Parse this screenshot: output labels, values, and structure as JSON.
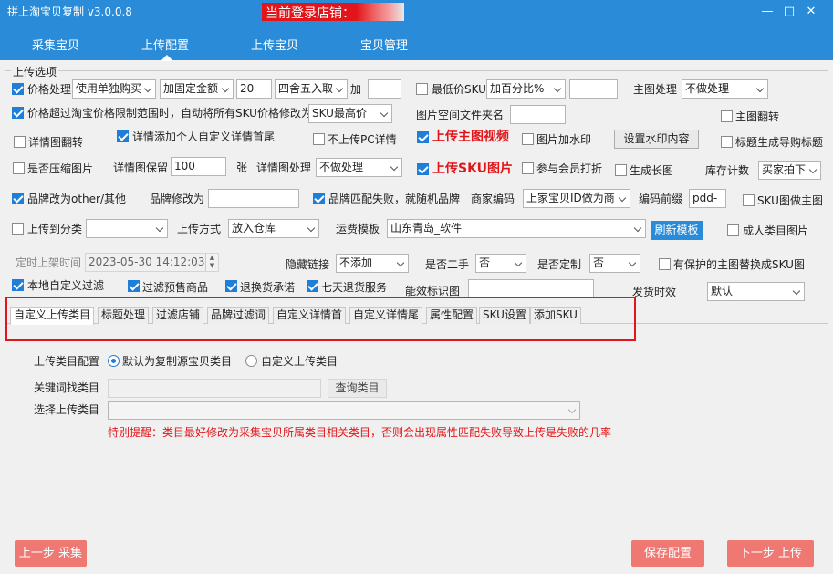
{
  "app": {
    "title": "拼上淘宝贝复制 v3.0.0.8",
    "login_label": "当前登录店铺：",
    "window_controls": {
      "minimize": "—",
      "restore": "□",
      "close": "✕"
    }
  },
  "nav": {
    "tabs": [
      "采集宝贝",
      "上传配置",
      "上传宝贝",
      "宝贝管理"
    ],
    "active": "上传配置"
  },
  "group": {
    "title": "上传选项"
  },
  "row1": {
    "price_process": {
      "label": "价格处理",
      "checked": true,
      "mode": "使用单独购买",
      "adjust": "加固定金额",
      "amount": "20",
      "rounding": "四舍五入取",
      "plus": "加",
      "plus_value": ""
    },
    "min_price_sku": {
      "label": "最低价SKU",
      "checked": false,
      "mode": "加百分比%",
      "value": ""
    },
    "main_image": {
      "label": "主图处理",
      "value": "不做处理"
    }
  },
  "row2": {
    "limit_price": {
      "label": "价格超过淘宝价格限制范围时，自动将所有SKU价格修改为",
      "checked": true,
      "value": "SKU最高价"
    },
    "image_folder": {
      "label": "图片空间文件夹名",
      "value": ""
    },
    "main_flip": {
      "label": "主图翻转",
      "checked": false
    }
  },
  "row3": {
    "detail_flip": {
      "label": "详情图翻转",
      "checked": false
    },
    "detail_custom": {
      "label": "详情添加个人自定义详情首尾",
      "checked": true
    },
    "no_pc_detail": {
      "label": "不上传PC详情",
      "checked": false
    },
    "main_video": {
      "label": "上传主图视频",
      "checked": true
    },
    "watermark": {
      "label": "图片加水印",
      "checked": false
    },
    "watermark_btn": "设置水印内容",
    "guide_title": {
      "label": "标题生成导购标题",
      "checked": false
    }
  },
  "row4": {
    "compress": {
      "label": "是否压缩图片",
      "checked": false
    },
    "detail_keep": {
      "label": "详情图保留",
      "value": "100",
      "unit": "张"
    },
    "detail_process": {
      "label": "详情图处理",
      "value": "不做处理"
    },
    "sku_image": {
      "label": "上传SKU图片",
      "checked": true
    },
    "member_discount": {
      "label": "参与会员打折",
      "checked": false
    },
    "long_image": {
      "label": "生成长图",
      "checked": false
    },
    "stock_count": {
      "label": "库存计数",
      "value": "买家拍下"
    }
  },
  "row5": {
    "brand_other": {
      "label": "品牌改为other/其他",
      "checked": true
    },
    "brand_change": {
      "label": "品牌修改为",
      "value": ""
    },
    "brand_match": {
      "label": "品牌匹配失败，就随机品牌",
      "checked": true
    },
    "merchant_code": {
      "label": "商家编码",
      "value": "上家宝贝ID做为商"
    },
    "code_prefix": {
      "label": "编码前缀",
      "value": "pdd-"
    },
    "sku_as_main": {
      "label": "SKU图做主图",
      "checked": false
    }
  },
  "row6": {
    "upload_category": {
      "label": "上传到分类",
      "checked": false,
      "value": ""
    },
    "upload_mode": {
      "label": "上传方式",
      "value": "放入仓库"
    },
    "shipping_template": {
      "label": "运费模板",
      "value": "山东青岛_软件"
    },
    "refresh_btn": "刷新模板",
    "adult_category": {
      "label": "成人类目图片",
      "checked": false
    }
  },
  "row7": {
    "schedule": {
      "label": "定时上架时间",
      "value": "2023-05-30 14:12:03"
    },
    "hidden_link": {
      "label": "隐藏链接",
      "value": "不添加"
    },
    "second_hand": {
      "label": "是否二手",
      "value": "否"
    },
    "customized": {
      "label": "是否定制",
      "value": "否"
    },
    "protected_main": {
      "label": "有保护的主图替换成SKU图",
      "checked": false
    }
  },
  "row8": {
    "local_filter": {
      "label": "本地自定义过滤",
      "checked": true
    },
    "filter_presale": {
      "label": "过滤预售商品",
      "checked": true
    },
    "refund_promise": {
      "label": "退换货承诺",
      "checked": true
    },
    "seven_day": {
      "label": "七天退货服务",
      "checked": true
    },
    "efficiency_icon": {
      "label": "能效标识图",
      "value": ""
    },
    "ship_time": {
      "label": "发货时效",
      "value": "默认"
    }
  },
  "subtabs": {
    "items": [
      "自定义上传类目",
      "标题处理",
      "过滤店铺",
      "品牌过滤词",
      "自定义详情首",
      "自定义详情尾",
      "属性配置",
      "SKU设置",
      "添加SKU"
    ],
    "active": "自定义上传类目"
  },
  "category_panel": {
    "config_label": "上传类目配置",
    "option_default": "默认为复制源宝贝类目",
    "option_custom": "自定义上传类目",
    "selected": "默认为复制源宝贝类目",
    "keyword_label": "关键词找类目",
    "keyword_value": "",
    "search_btn": "查询类目",
    "select_label": "选择上传类目",
    "select_value": "",
    "warning": "特别提醒：类目最好修改为采集宝贝所属类目相关类目，否则会出现属性匹配失败导致上传是失败的几率"
  },
  "footer": {
    "prev": "上一步 采集",
    "save": "保存配置",
    "next": "下一步 上传"
  },
  "colors": {
    "header_blue": "#2a8cd8",
    "accent_red": "#e2161a",
    "button_red": "#f07873",
    "checkbox_blue": "#1f7ed8"
  }
}
